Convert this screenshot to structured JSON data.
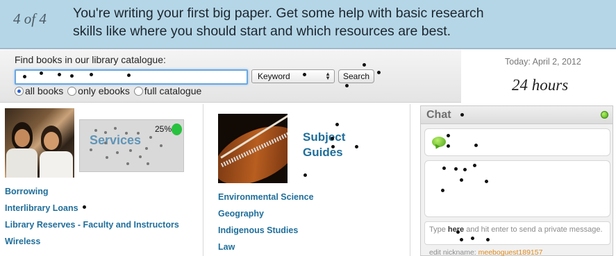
{
  "banner": {
    "step": "4 of 4",
    "message_line1": "You're writing your first big paper. Get some help with basic research",
    "message_line2": "skills like where you should start and which resources are best."
  },
  "search": {
    "label": "Find books in our library catalogue:",
    "input_value": "",
    "select_value": "Keyword",
    "button_label": "Search",
    "scope_options": [
      {
        "label": "all books",
        "selected": true
      },
      {
        "label": "only ebooks",
        "selected": false
      },
      {
        "label": "full catalogue",
        "selected": false
      }
    ]
  },
  "date_box": {
    "today": "Today: April 2, 2012",
    "hours": "24 hours"
  },
  "services": {
    "title": "Services",
    "percent": "25%",
    "status_color": "#27c23f",
    "links": [
      "Borrowing",
      "Interlibrary Loans",
      "Library Reserves - Faculty and Instructors",
      "Wireless"
    ]
  },
  "subject_guides": {
    "title_line1": "Subject",
    "title_line2": "Guides",
    "links": [
      "Environmental Science",
      "Geography",
      "Indigenous Studies",
      "Law"
    ]
  },
  "chat": {
    "title": "Chat",
    "status_color": "#4aa315",
    "input_prefix": "Type ",
    "input_bold": "here",
    "input_suffix": " and hit enter to send a private message.",
    "nickname_label": "edit nickname: ",
    "nickname": "meeboguest189157"
  },
  "colors": {
    "banner_bg": "#b5d6e6",
    "link": "#1f6e9a",
    "services_title": "#5f95b8"
  }
}
